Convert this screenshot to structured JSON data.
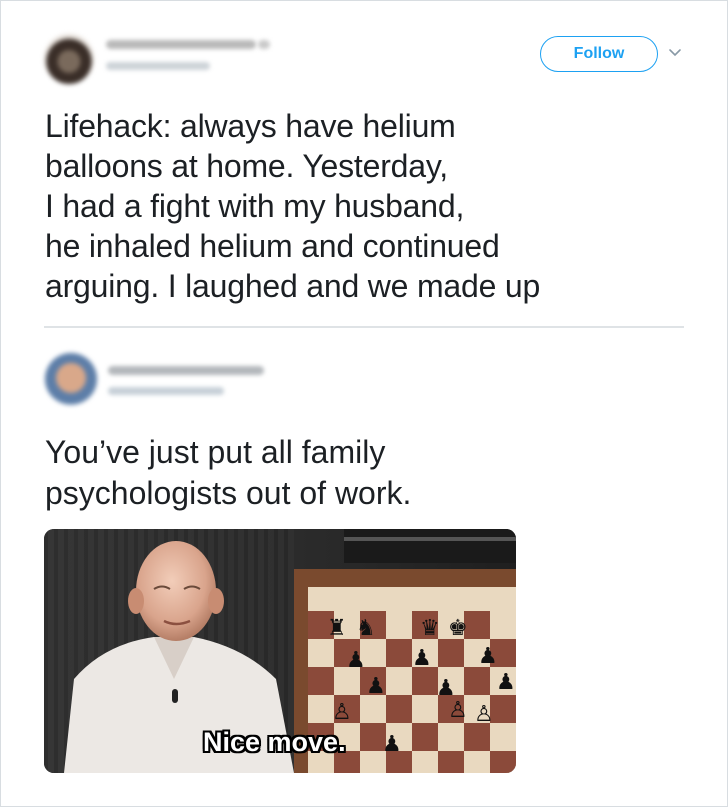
{
  "tweet": {
    "follow_label": "Follow",
    "text_lines": [
      "Lifehack: always have helium",
      "balloons at home. Yesterday,",
      "I had a fight with my husband,",
      "he inhaled helium and continued",
      "arguing. I laughed and we made up"
    ]
  },
  "reply": {
    "text_lines": [
      "You’ve just put all family",
      "psychologists out of work."
    ],
    "media": {
      "caption": "Nice move."
    }
  },
  "colors": {
    "accent": "#1da1f2",
    "text": "#1c2024",
    "divider": "#dfe3e6"
  },
  "icons": {
    "more": "chevron-down-icon"
  }
}
